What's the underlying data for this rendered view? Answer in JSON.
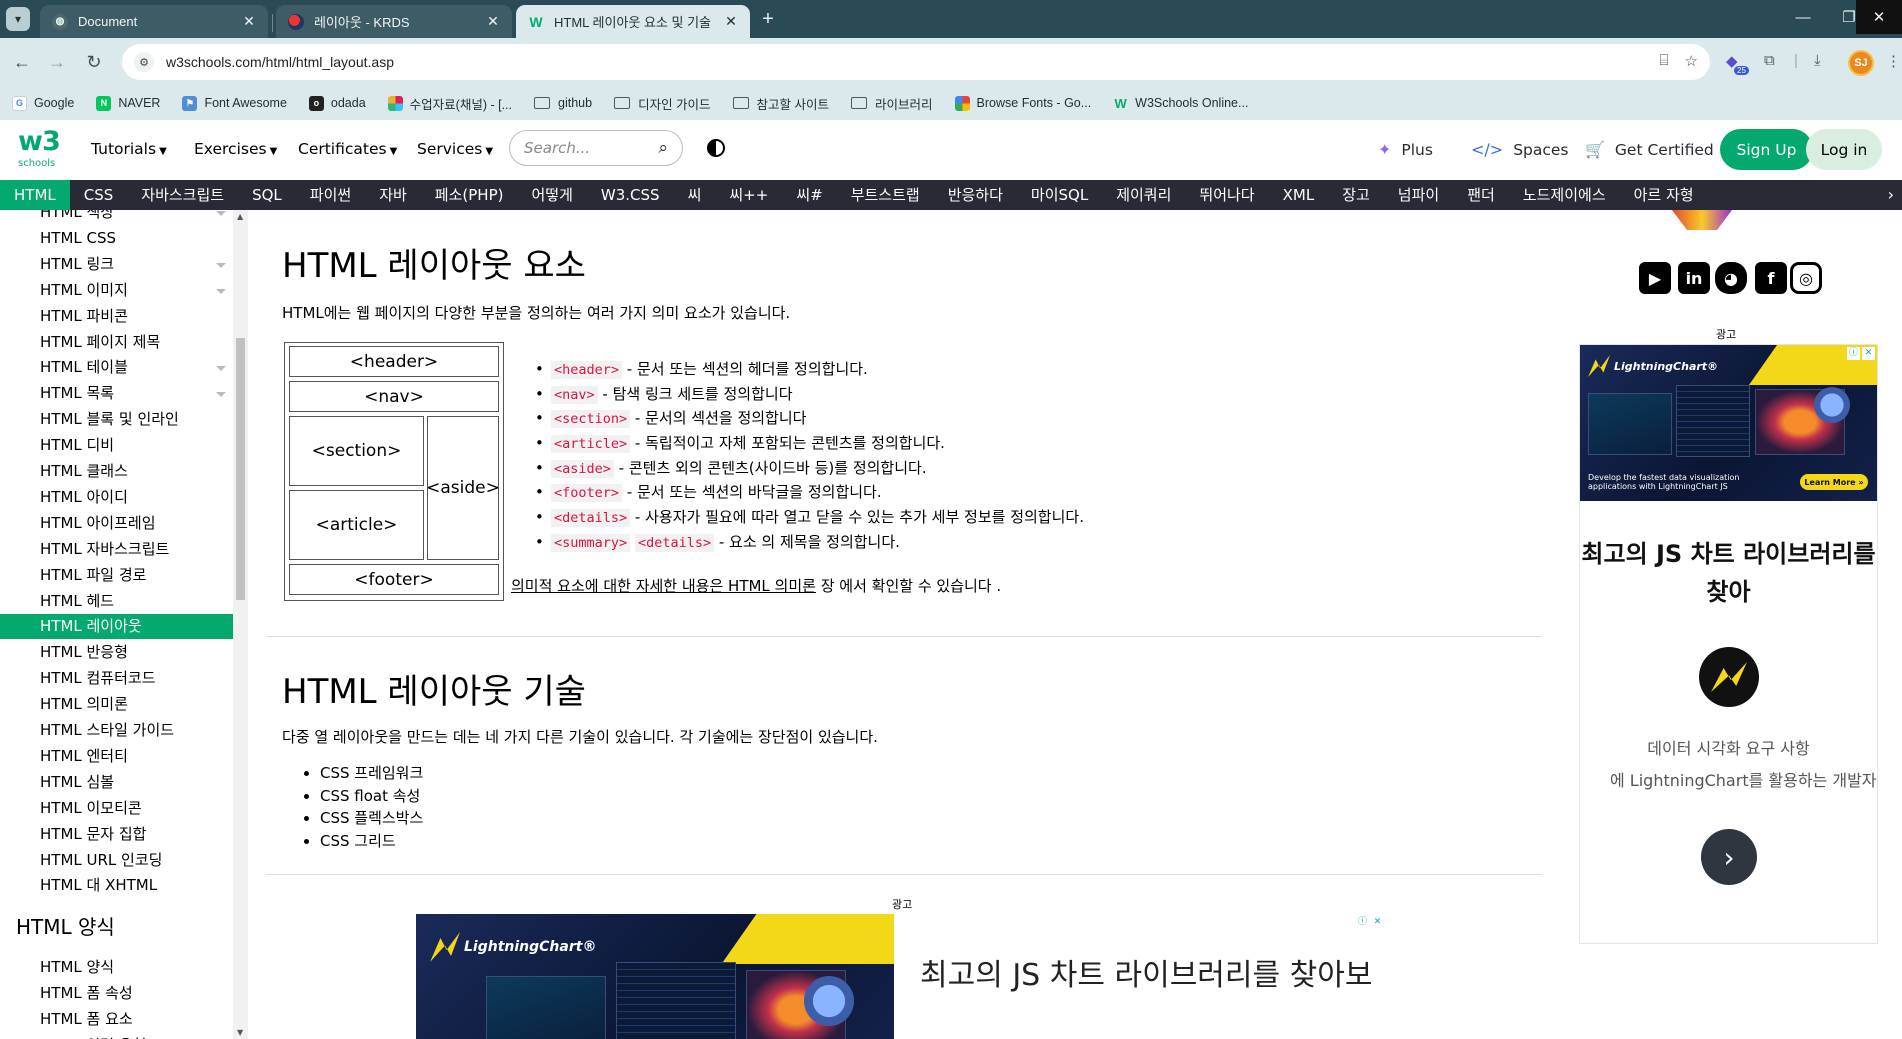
{
  "browser": {
    "tabs": [
      {
        "title": "Document",
        "favicon": "globe-icon",
        "active": false
      },
      {
        "title": "레이아웃 - KRDS",
        "favicon": "krds-icon",
        "active": false
      },
      {
        "title": "HTML 레이아웃 요소 및 기술",
        "favicon": "w3schools-icon",
        "active": true
      }
    ],
    "url": "w3schools.com/html/html_layout.asp",
    "profile_initials": "SJ",
    "extension_badge": "25",
    "bookmarks": [
      {
        "label": "Google",
        "icon": "google-icon"
      },
      {
        "label": "NAVER",
        "icon": "naver-icon"
      },
      {
        "label": "Font Awesome",
        "icon": "flag-icon"
      },
      {
        "label": "odada",
        "icon": "odada-icon"
      },
      {
        "label": "수업자료(채널) - [...",
        "icon": "slack-icon"
      },
      {
        "label": "github",
        "icon": "folder-icon"
      },
      {
        "label": "디자인 가이드",
        "icon": "folder-icon"
      },
      {
        "label": "참고할 사이트",
        "icon": "folder-icon"
      },
      {
        "label": "라이브러리",
        "icon": "folder-icon"
      },
      {
        "label": "Browse Fonts - Go...",
        "icon": "google-fonts-icon"
      },
      {
        "label": "W3Schools Online...",
        "icon": "w3schools-icon"
      }
    ]
  },
  "header": {
    "logo_top": "w3",
    "logo_bottom": "schools",
    "menus": [
      "Tutorials",
      "Exercises",
      "Certificates",
      "Services"
    ],
    "search_placeholder": "Search...",
    "plus": "Plus",
    "spaces": "Spaces",
    "get_certified": "Get Certified",
    "signup": "Sign Up",
    "login": "Log in"
  },
  "subnav": [
    "HTML",
    "CSS",
    "자바스크립트",
    "SQL",
    "파이썬",
    "자바",
    "페소(PHP)",
    "어떻게",
    "W3.CSS",
    "씨",
    "씨++",
    "씨#",
    "부트스트랩",
    "반응하다",
    "마이SQL",
    "제이쿼리",
    "뛰어나다",
    "XML",
    "장고",
    "넘파이",
    "팬더",
    "노드제이에스",
    "아르 자형"
  ],
  "sidebar": {
    "items": [
      "HTML 색상",
      "HTML CSS",
      "HTML 링크",
      "HTML 이미지",
      "HTML 파비콘",
      "HTML 페이지 제목",
      "HTML 테이블",
      "HTML 목록",
      "HTML 블록 및 인라인",
      "HTML 디비",
      "HTML 클래스",
      "HTML 아이디",
      "HTML 아이프레임",
      "HTML 자바스크립트",
      "HTML 파일 경로",
      "HTML 헤드",
      "HTML 레이아웃",
      "HTML 반응형",
      "HTML 컴퓨터코드",
      "HTML 의미론",
      "HTML 스타일 가이드",
      "HTML 엔터티",
      "HTML 심볼",
      "HTML 이모티콘",
      "HTML 문자 집합",
      "HTML URL 인코딩",
      "HTML 대 XHTML"
    ],
    "section_title": "HTML 양식",
    "form_items": [
      "HTML 양식",
      "HTML 폼 속성",
      "HTML 폼 요소",
      "HTML 입력 유형"
    ]
  },
  "content": {
    "h1": "HTML 레이아웃 요소",
    "intro": "HTML에는 웹 페이지의 다양한 부분을 정의하는 여러 가지 의미 요소가 있습니다.",
    "diagram": {
      "header": "<header>",
      "nav": "<nav>",
      "section": "<section>",
      "article": "<article>",
      "aside": "<aside>",
      "footer": "<footer>"
    },
    "elements": [
      {
        "tag": "<header>",
        "text": " - 문서 또는 섹션의 헤더를 정의합니다."
      },
      {
        "tag": "<nav>",
        "text": " - 탐색 링크 세트를 정의합니다"
      },
      {
        "tag": "<section>",
        "text": " - 문서의 섹션을 정의합니다"
      },
      {
        "tag": "<article>",
        "text": " - 독립적이고 자체 포함되는 콘텐츠를 정의합니다."
      },
      {
        "tag": "<aside>",
        "text": " - 콘텐츠 외의 콘텐츠(사이드바 등)를 정의합니다."
      },
      {
        "tag": "<footer>",
        "text": " - 문서 또는 섹션의 바닥글을 정의합니다."
      },
      {
        "tag": "<details>",
        "text": " - 사용자가 필요에 따라 열고 닫을 수 있는 추가 세부 정보를 정의합니다."
      },
      {
        "tag": "<summary>",
        "tag2": "<details>",
        "text": " - 요소 의 제목을 정의합니다."
      }
    ],
    "semantic_link": "의미적 요소에 대한 자세한 내용은 HTML 의미론",
    "semantic_after": " 장 에서 확인할 수 있습니다 .",
    "h2": "HTML 레이아웃 기술",
    "techniques_intro": "다중 열 레이아웃을 만드는 데는 네 가지 다른 기술이 있습니다. 각 기술에는 장단점이 있습니다.",
    "techniques": [
      "CSS 프레임워크",
      "CSS float 속성",
      "CSS 플렉스박스",
      "CSS 그리드"
    ],
    "ad_label": "광고"
  },
  "right_ad": {
    "label": "광고",
    "brand": "LightningChart®",
    "banner_text": "Develop the fastest data visualization applications with LightningChart JS",
    "learn_more": "Learn More »",
    "title": "최고의 JS 차트 라이브러리를 찾아",
    "desc1": "데이터 시각화 요구 사항",
    "desc2": "에 LightningChart를 활용하는 개발자"
  },
  "bottom_ad": {
    "brand": "LightningChart®",
    "headline": "최고의 JS 차트 라이브러리를 찾아보"
  },
  "colors": {
    "brand_green": "#04aa6d",
    "dark_nav": "#282a35",
    "tag_red": "#dc143c",
    "ad_yellow": "#f3d81a"
  }
}
